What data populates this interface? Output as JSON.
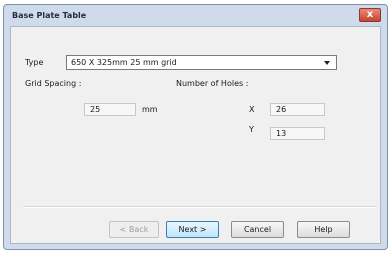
{
  "dialog": {
    "title": "Base Plate Table",
    "close_label": "x"
  },
  "type_row": {
    "label": "Type",
    "selected": "650 X 325mm 25 mm grid"
  },
  "grid_spacing": {
    "label": "Grid Spacing :",
    "value": "25",
    "unit": "mm"
  },
  "holes": {
    "label": "Number of Holes :",
    "x_label": "X",
    "x_value": "26",
    "y_label": "Y",
    "y_value": "13"
  },
  "buttons": {
    "back": "< Back",
    "next": "Next >",
    "cancel": "Cancel",
    "help": "Help"
  },
  "colors": {
    "frame": "#cfdbea",
    "client": "#f0f0f0",
    "close": "#c8432f",
    "default_button": "#bee6fd"
  }
}
